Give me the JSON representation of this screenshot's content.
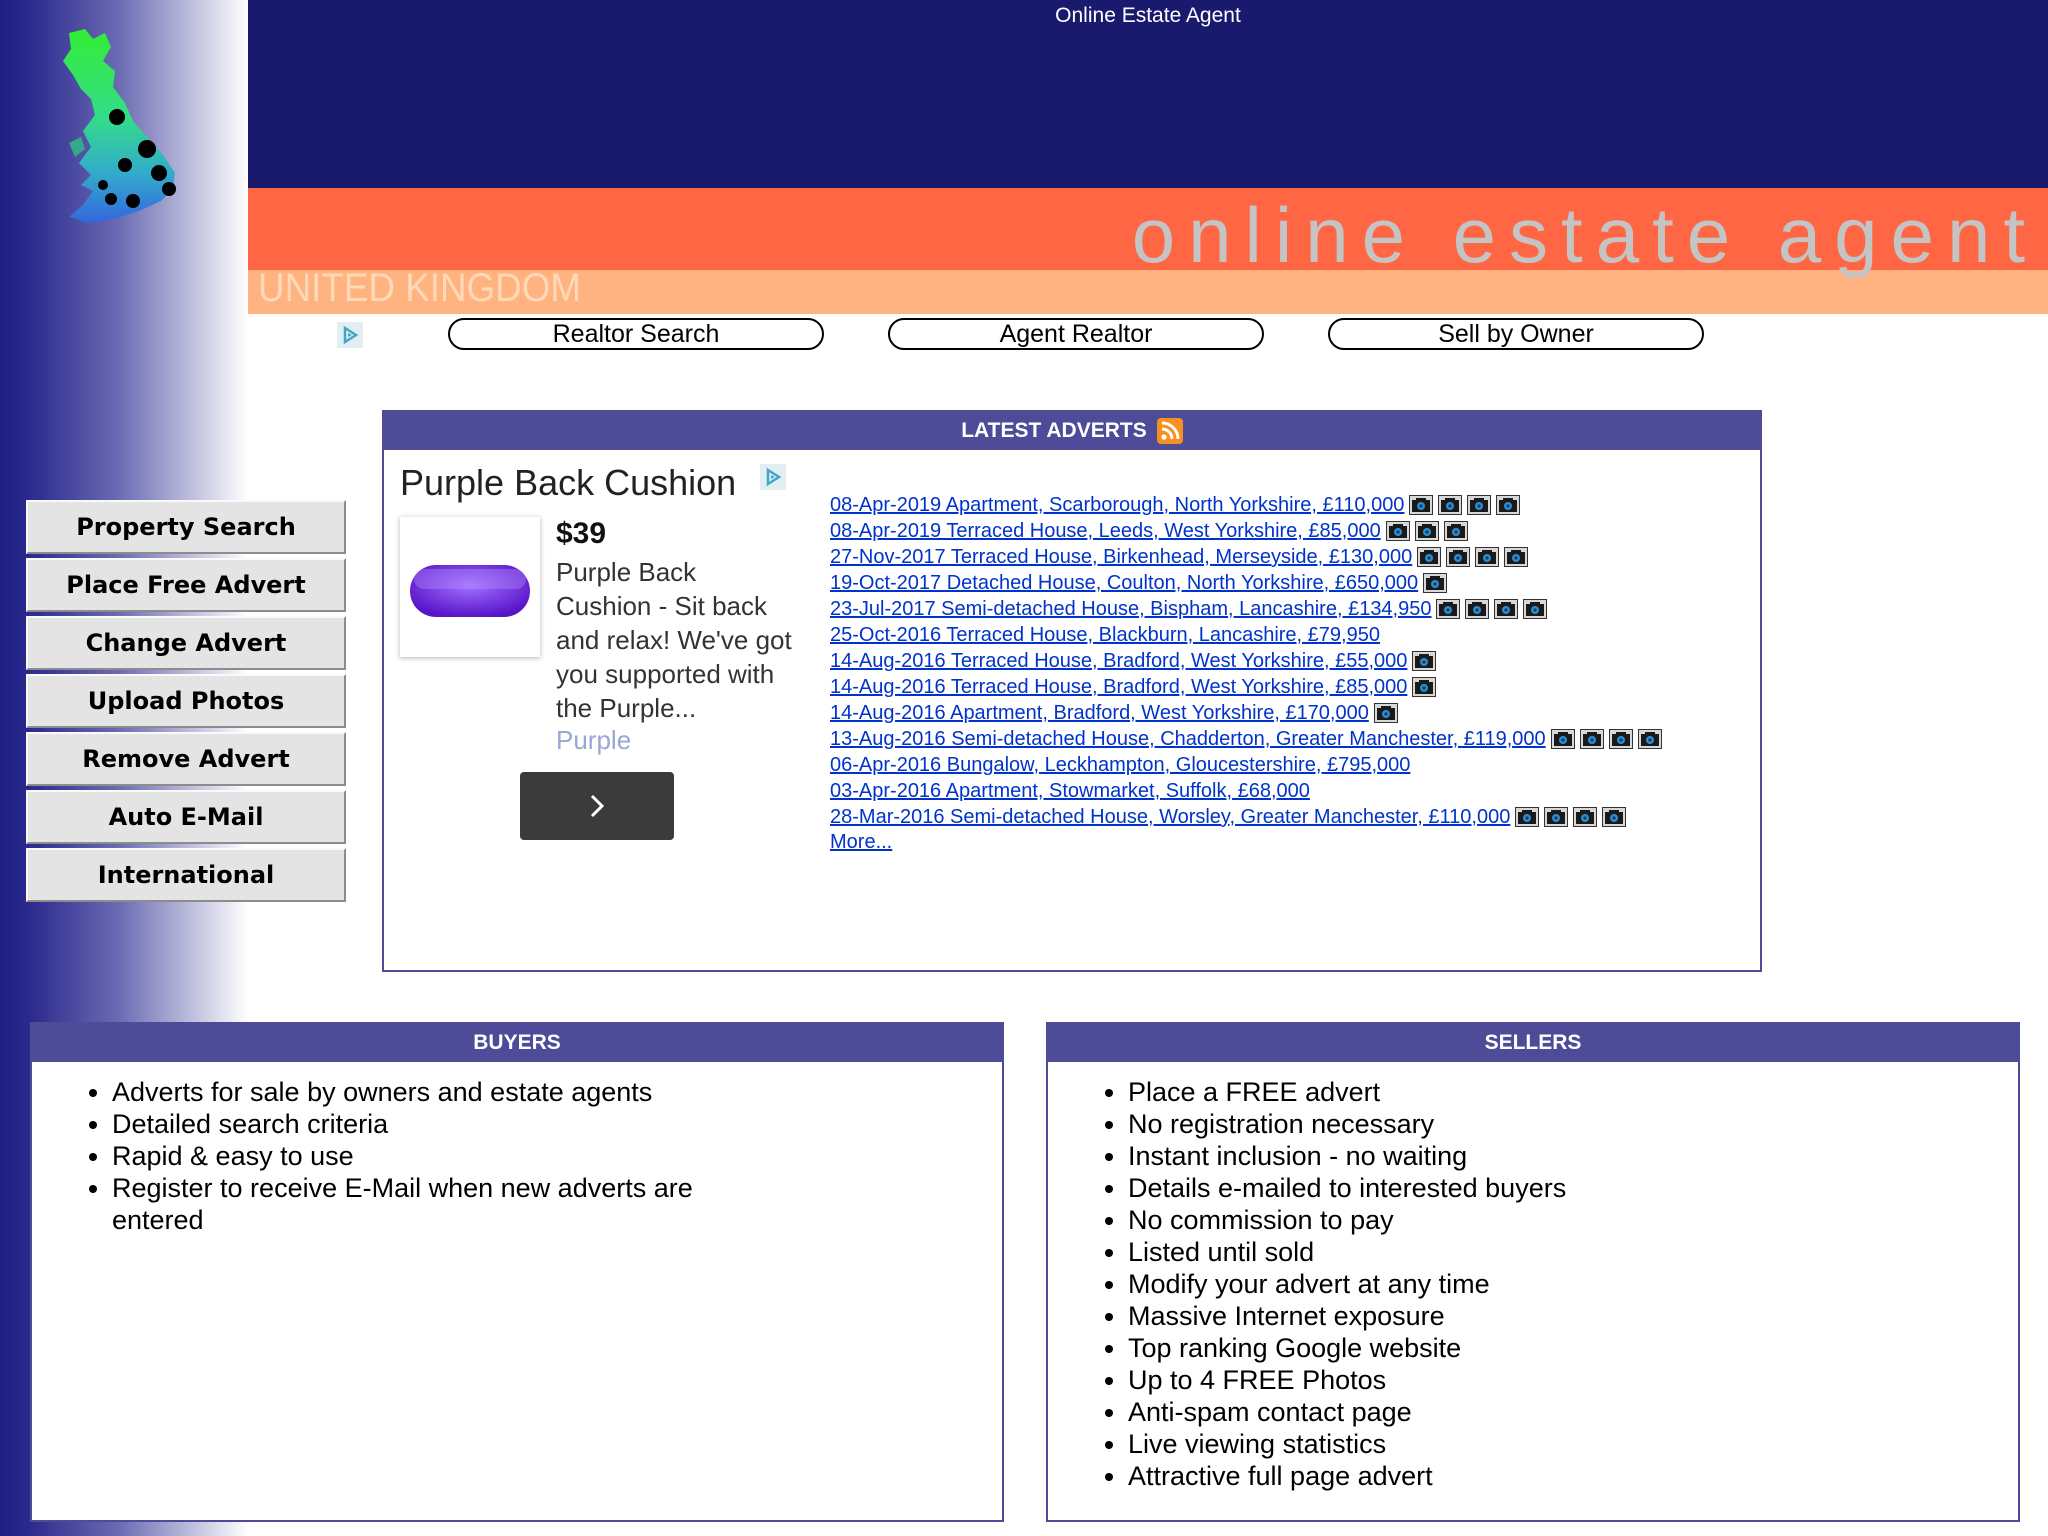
{
  "header": {
    "site_title": "Online Estate Agent",
    "brand_big": "online estate agent",
    "country": "UNITED KINGDOM"
  },
  "nav_pills": [
    "Realtor Search",
    "Agent Realtor",
    "Sell by Owner"
  ],
  "sidebar": {
    "items": [
      "Property Search",
      "Place Free Advert",
      "Change Advert",
      "Upload Photos",
      "Remove Advert",
      "Auto E-Mail",
      "International"
    ]
  },
  "latest": {
    "heading": "LATEST ADVERTS",
    "more_label": "More...",
    "items": [
      {
        "text": "08-Apr-2019 Apartment, Scarborough, North Yorkshire, £110,000 ",
        "photos": 4
      },
      {
        "text": "08-Apr-2019 Terraced House, Leeds, West Yorkshire, £85,000 ",
        "photos": 3
      },
      {
        "text": "27-Nov-2017 Terraced House, Birkenhead, Merseyside, £130,000 ",
        "photos": 4
      },
      {
        "text": "19-Oct-2017 Detached House, Coulton, North Yorkshire, £650,000 ",
        "photos": 1
      },
      {
        "text": "23-Jul-2017 Semi-detached House, Bispham, Lancashire, £134,950 ",
        "photos": 4
      },
      {
        "text": "25-Oct-2016 Terraced House, Blackburn, Lancashire, £79,950 ",
        "photos": 0
      },
      {
        "text": "14-Aug-2016 Terraced House, Bradford, West Yorkshire, £55,000 ",
        "photos": 1
      },
      {
        "text": "14-Aug-2016 Terraced House, Bradford, West Yorkshire, £85,000 ",
        "photos": 1
      },
      {
        "text": "14-Aug-2016 Apartment, Bradford, West Yorkshire, £170,000 ",
        "photos": 1
      },
      {
        "text": "13-Aug-2016 Semi-detached House, Chadderton, Greater Manchester, £119,000 ",
        "photos": 4
      },
      {
        "text": "06-Apr-2016 Bungalow, Leckhampton, Gloucestershire, £795,000 ",
        "photos": 0
      },
      {
        "text": "03-Apr-2016 Apartment, Stowmarket, Suffolk, £68,000 ",
        "photos": 0
      },
      {
        "text": "28-Mar-2016 Semi-detached House, Worsley, Greater Manchester, £110,000 ",
        "photos": 4
      }
    ]
  },
  "ad": {
    "title": "Purple Back Cushion",
    "price": "$39",
    "description": "Purple Back Cushion - Sit back and relax! We've got you supported with the Purple...",
    "brand": "Purple"
  },
  "buyers": {
    "heading": "BUYERS",
    "items": [
      "Adverts for sale by owners and estate agents",
      "Detailed search criteria",
      "Rapid & easy to use",
      "Register to receive E-Mail when new adverts are entered"
    ]
  },
  "sellers": {
    "heading": "SELLERS",
    "items": [
      "Place a FREE advert",
      "No registration necessary",
      "Instant inclusion - no waiting",
      "Details e-mailed to interested buyers",
      "No commission to pay",
      "Listed until sold",
      "Modify your advert at any time",
      "Massive Internet exposure",
      "Top ranking Google website",
      "Up to 4 FREE Photos",
      "Anti-spam contact page",
      "Live viewing statistics",
      "Attractive full page advert"
    ]
  },
  "icons": {
    "map": "uk-map-icon",
    "adchoices": "adchoices-icon",
    "rss": "rss-icon",
    "camera": "camera-icon",
    "chevron": "chevron-right-icon"
  },
  "colors": {
    "top_band": "#19196e",
    "orange_band": "#ff6644",
    "peach_band": "#ffb380",
    "panel_header": "#4e4c99",
    "link": "#0033cc"
  }
}
